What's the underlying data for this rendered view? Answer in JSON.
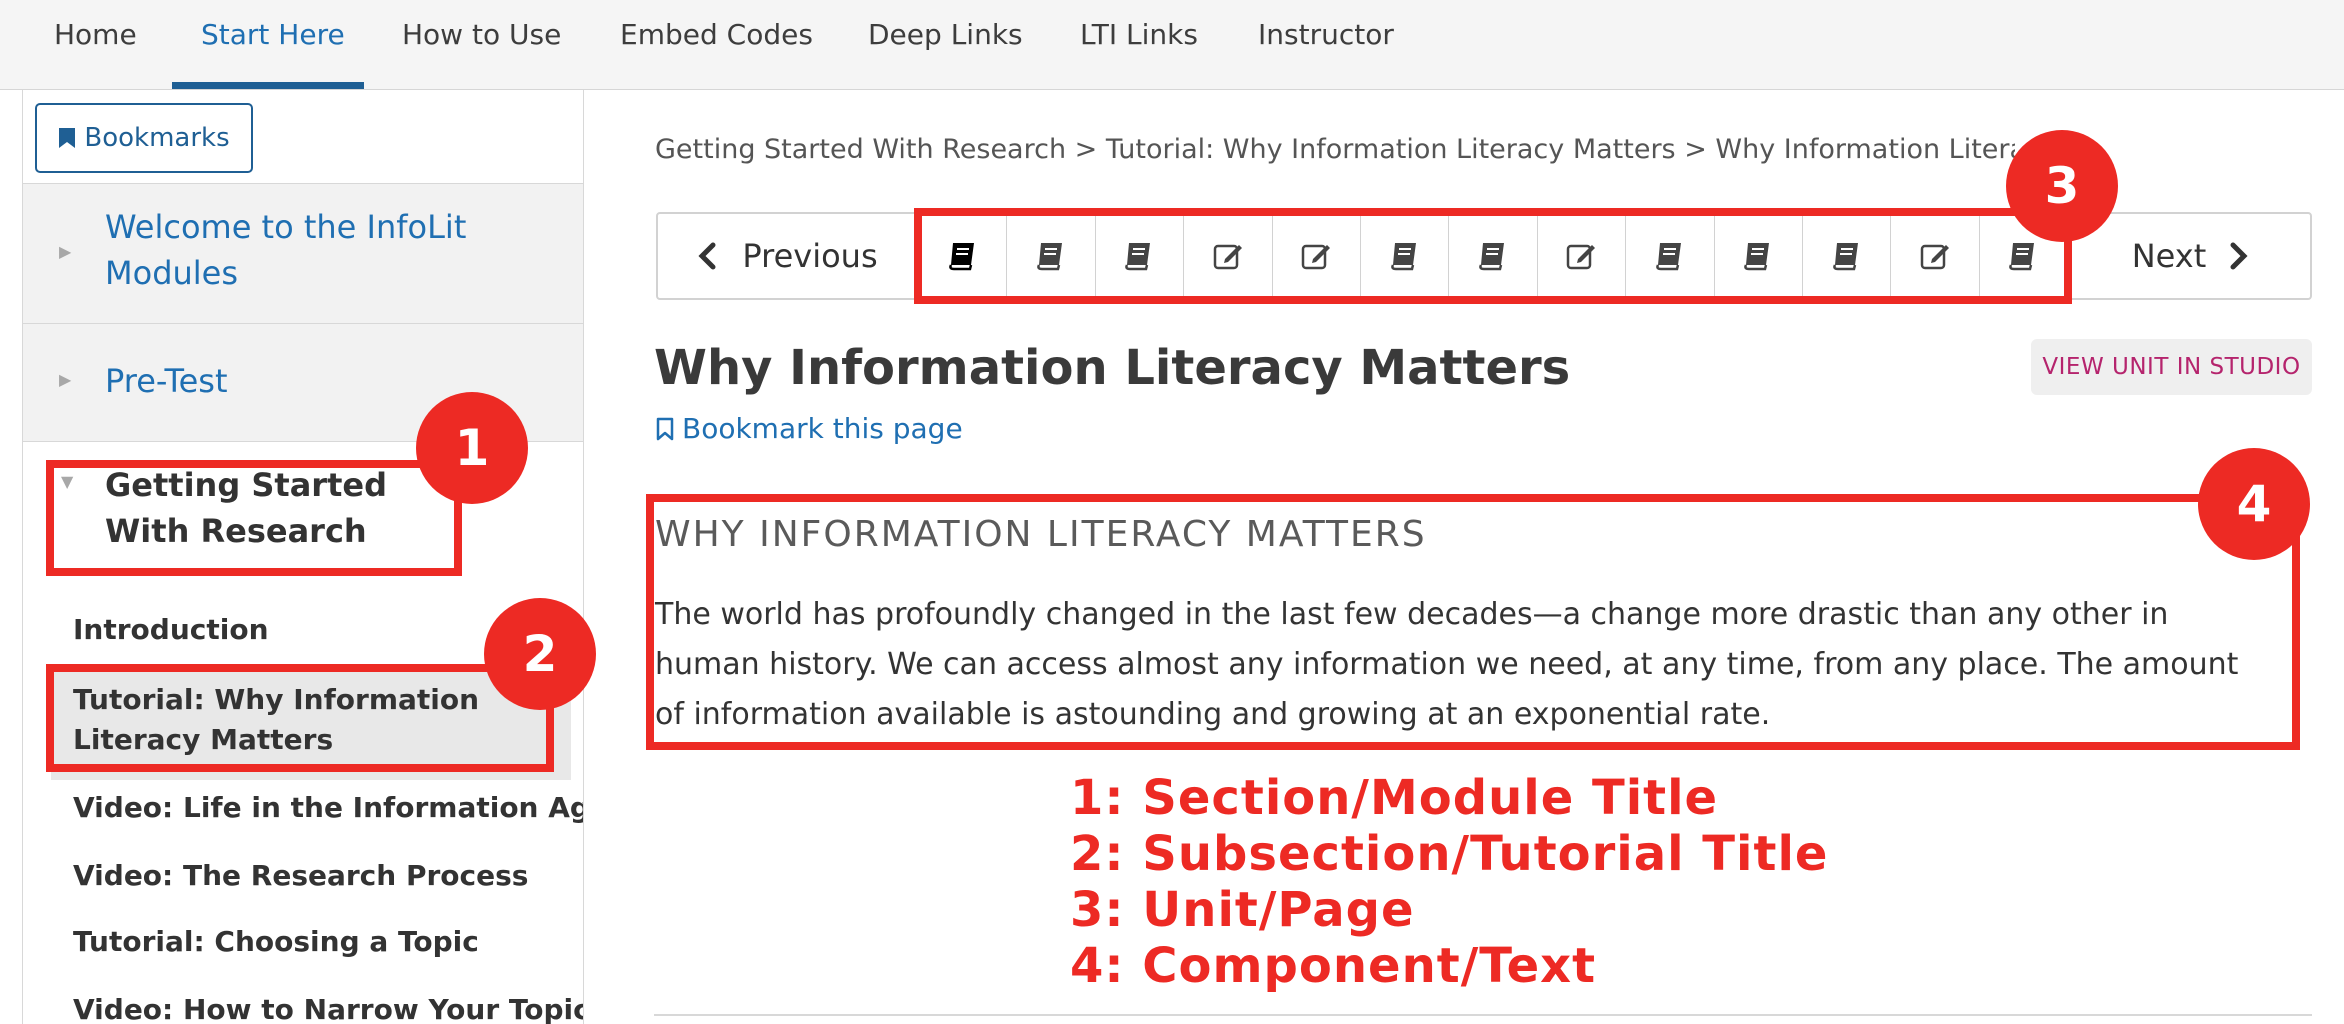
{
  "topnav": {
    "tabs": [
      {
        "label": "Home"
      },
      {
        "label": "Start Here"
      },
      {
        "label": "How to Use"
      },
      {
        "label": "Embed Codes"
      },
      {
        "label": "Deep Links"
      },
      {
        "label": "LTI Links"
      },
      {
        "label": "Instructor"
      }
    ],
    "active_tab": "Start Here"
  },
  "sidebar": {
    "bookmarks_label": "Bookmarks",
    "sections": [
      {
        "label": "Welcome to the InfoLit Modules",
        "expanded": false
      },
      {
        "label": "Pre-Test",
        "expanded": false
      },
      {
        "label": "Getting Started With Research",
        "expanded": true
      }
    ],
    "subsections": [
      {
        "label": "Introduction"
      },
      {
        "label": "Tutorial: Why Information Literacy Matters",
        "current": true
      },
      {
        "label": "Video: Life in the Information Age"
      },
      {
        "label": "Video: The Research Process"
      },
      {
        "label": "Tutorial: Choosing a Topic"
      },
      {
        "label": "Video: How to Narrow Your Topic"
      }
    ]
  },
  "main": {
    "breadcrumb": "Getting Started With Research > Tutorial: Why Information Literacy Matters > Why Information Literacy M",
    "sequence": {
      "previous_label": "Previous",
      "next_label": "Next",
      "units": [
        {
          "type": "book",
          "active": true
        },
        {
          "type": "book"
        },
        {
          "type": "book"
        },
        {
          "type": "edit"
        },
        {
          "type": "edit"
        },
        {
          "type": "book"
        },
        {
          "type": "book"
        },
        {
          "type": "edit"
        },
        {
          "type": "book"
        },
        {
          "type": "book"
        },
        {
          "type": "book"
        },
        {
          "type": "edit"
        },
        {
          "type": "book"
        }
      ]
    },
    "page_title": "Why Information Literacy Matters",
    "studio_button": "VIEW UNIT IN STUDIO",
    "bookmark_page": "Bookmark this page",
    "component_heading": "WHY INFORMATION LITERACY MATTERS",
    "component_text": "The world has profoundly changed in the last few decades—a change more drastic than any other in human history. We can access almost any information we need, at any time, from any place. The amount of information available is astounding and growing at an exponential rate."
  },
  "annotations": {
    "color": "#ed2a24",
    "markers": [
      "1",
      "2",
      "3",
      "4"
    ],
    "legend": [
      "1: Section/Module Title",
      "2: Subsection/Tutorial Title",
      "3: Unit/Page",
      "4: Component/Text"
    ]
  },
  "colors": {
    "link_blue": "#1f6fb2",
    "nav_underline": "#1f5f94",
    "studio_pink": "#b5246d"
  }
}
